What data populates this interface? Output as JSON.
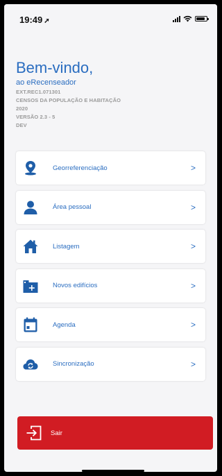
{
  "status_bar": {
    "time": "19:49",
    "location_arrow": "➚"
  },
  "header": {
    "welcome": "Bem-vindo,",
    "subtitle": "ao eRecenseador",
    "meta_lines": [
      "EXT.REC1.071301",
      "CENSOS DA POPULAÇÃO E HABITAÇÃO",
      "2020",
      "VERSÃO 2.3 - 5",
      "DEV"
    ]
  },
  "menu": {
    "items": [
      {
        "label": "Georreferenciação",
        "icon": "location-pin-icon",
        "chevron": ">"
      },
      {
        "label": "Área pessoal",
        "icon": "person-icon",
        "chevron": ">"
      },
      {
        "label": "Listagem",
        "icon": "house-icon",
        "chevron": ">"
      },
      {
        "label": "Novos edifícios",
        "icon": "add-building-icon",
        "chevron": ">"
      },
      {
        "label": "Agenda",
        "icon": "calendar-icon",
        "chevron": ">"
      },
      {
        "label": "Sincronização",
        "icon": "cloud-sync-icon",
        "chevron": ">"
      }
    ]
  },
  "logout": {
    "label": "Sair",
    "icon": "exit-icon"
  },
  "colors": {
    "accent": "#2a6dc0",
    "danger": "#d11c23",
    "background": "#f5f5f7"
  }
}
